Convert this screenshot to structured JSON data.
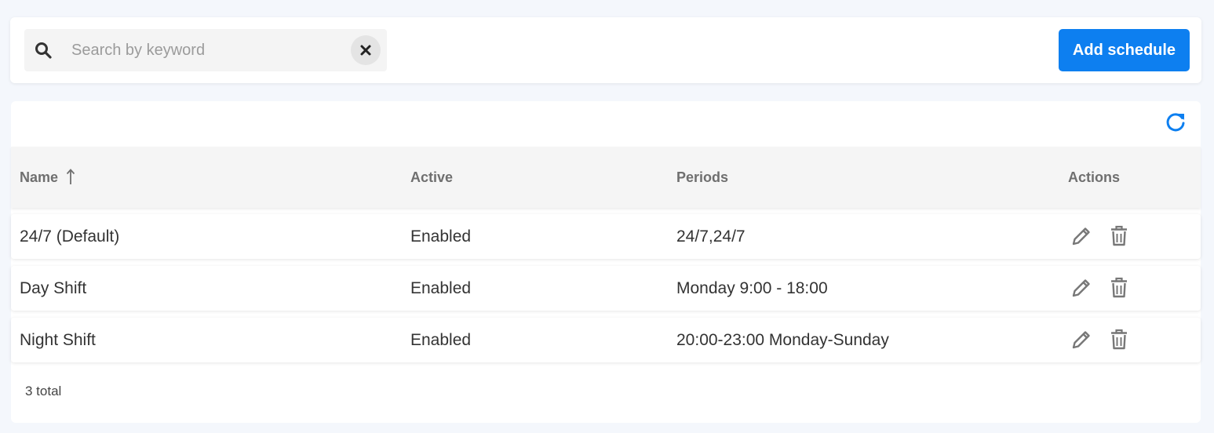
{
  "toolbar": {
    "search": {
      "placeholder": "Search by keyword",
      "value": "",
      "icon": "search-icon",
      "clear_icon": "close-icon"
    },
    "add_button_label": "Add schedule"
  },
  "colors": {
    "accent": "#0d7ff0",
    "page_background": "#f4f7fc",
    "header_background": "#f5f5f5"
  },
  "table": {
    "refresh_icon": "refresh-icon",
    "columns": {
      "name": "Name",
      "active": "Active",
      "periods": "Periods",
      "actions": "Actions"
    },
    "sort": {
      "column": "name",
      "direction": "ascending"
    },
    "rows": [
      {
        "name": "24/7 (Default)",
        "active": "Enabled",
        "periods": "24/7,24/7"
      },
      {
        "name": "Day Shift",
        "active": "Enabled",
        "periods": "Monday 9:00 - 18:00"
      },
      {
        "name": "Night Shift",
        "active": "Enabled",
        "periods": "20:00-23:00 Monday-Sunday"
      }
    ],
    "row_action_icons": [
      "pencil-icon",
      "trash-icon"
    ],
    "total_label": "3 total"
  }
}
